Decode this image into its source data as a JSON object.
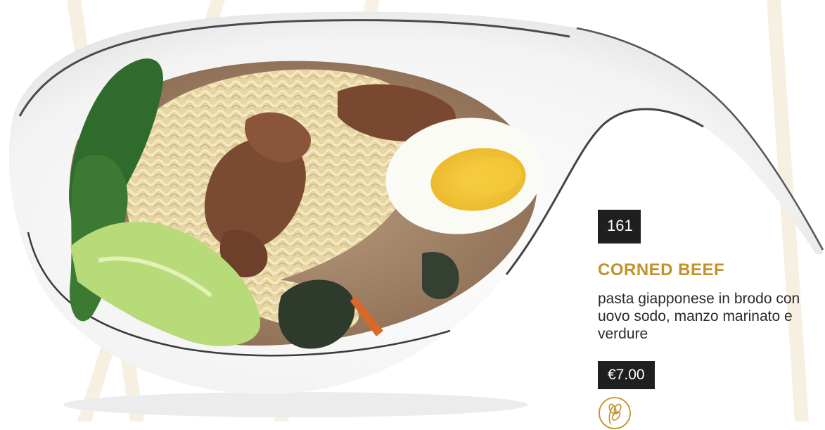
{
  "dish": {
    "code": "161",
    "name": "CORNED BEEF",
    "description": "pasta giapponese in brodo con uovo sodo, manzo marinato e verdure",
    "price": "€7.00",
    "allergen_icon": "gluten-wheat-icon"
  },
  "colors": {
    "accent": "#c29228",
    "badge_bg": "#1f1f1f",
    "background": "#ffffff"
  }
}
